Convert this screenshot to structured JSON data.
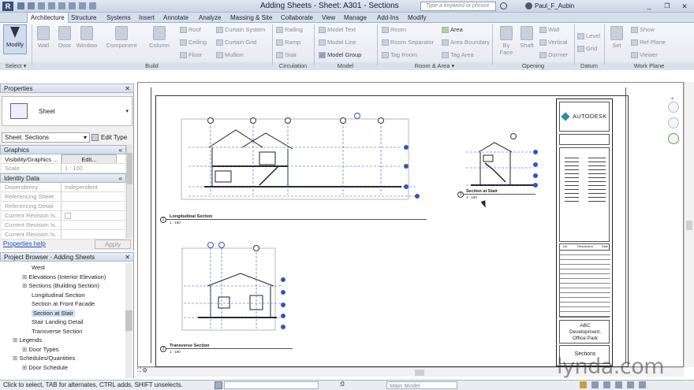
{
  "title": "Adding Sheets - Sheet: A301 - Sections",
  "search_placeholder": "Type a keyword or phrase",
  "user": "Paul_F_Aubin",
  "tabs": [
    "Architecture",
    "Structure",
    "Systems",
    "Insert",
    "Annotate",
    "Analyze",
    "Massing & Site",
    "Collaborate",
    "View",
    "Manage",
    "Add-Ins",
    "Modify"
  ],
  "ribbon": {
    "modify": "Modify",
    "wall": "Wall",
    "door": "Door",
    "window": "Window",
    "component": "Component",
    "column": "Column",
    "roof": "Roof",
    "ceiling": "Ceiling",
    "floor": "Floor",
    "curtain_system": "Curtain System",
    "curtain_grid": "Curtain Grid",
    "mullion": "Mullion",
    "railing": "Railing",
    "ramp": "Ramp",
    "stair": "Stair",
    "model_text": "Model Text",
    "model_line": "Model Line",
    "model_group": "Model Group",
    "room": "Room",
    "room_separator": "Room Separator",
    "tag_room": "Tag Room",
    "area": "Area",
    "area_boundary": "Area Boundary",
    "tag_area": "Tag Area",
    "by_face": "By Face",
    "shaft": "Shaft",
    "wall_op": "Wall",
    "vertical": "Vertical",
    "dormer": "Dormer",
    "level": "Level",
    "grid": "Grid",
    "set": "Set",
    "show": "Show",
    "ref_plane": "Ref Plane",
    "viewer": "Viewer",
    "panels": {
      "select": "Select",
      "build": "Build",
      "circulation": "Circulation",
      "model": "Model",
      "room_area": "Room & Area",
      "opening": "Opening",
      "datum": "Datum",
      "work_plane": "Work Plane"
    }
  },
  "properties": {
    "header": "Properties",
    "type_name": "Sheet",
    "selector": "Sheet: Sections",
    "edit_type": "Edit Type",
    "graphics": "Graphics",
    "rows": [
      {
        "label": "Visibility/Graphics ...",
        "value": "Edit..."
      },
      {
        "label": "Scale",
        "value": "1 : 100"
      }
    ],
    "identity": "Identity Data",
    "id_rows": [
      {
        "label": "Dependency",
        "value": "Independent"
      },
      {
        "label": "Referencing Sheet",
        "value": ""
      },
      {
        "label": "Referencing Detail",
        "value": ""
      },
      {
        "label": "Current Revision Is...",
        "value": ""
      },
      {
        "label": "Current Revision Is...",
        "value": ""
      },
      {
        "label": "Current Revision Is...",
        "value": ""
      }
    ],
    "help": "Properties help",
    "apply": "Apply"
  },
  "browser": {
    "header": "Project Browser - Adding Sheets",
    "items": [
      {
        "label": "West",
        "indent": 3
      },
      {
        "label": "Elevations (Interior Elevation)",
        "indent": 2
      },
      {
        "label": "Sections (Building Section)",
        "indent": 2
      },
      {
        "label": "Longitudinal Section",
        "indent": 3
      },
      {
        "label": "Section at Front Facade",
        "indent": 3
      },
      {
        "label": "Section at Stair",
        "indent": 3,
        "selected": true
      },
      {
        "label": "Stair Landing Detail",
        "indent": 3
      },
      {
        "label": "Transverse Section",
        "indent": 3
      },
      {
        "label": "Legends",
        "indent": 1
      },
      {
        "label": "Door Types",
        "indent": 2
      },
      {
        "label": "Schedules/Quantities",
        "indent": 1
      },
      {
        "label": "Door Schedule",
        "indent": 2
      }
    ]
  },
  "sheet": {
    "view1_title": "Longitudinal Section",
    "view2_title": "Section at Stair",
    "view3_title": "Transverse Section",
    "view1_num": "1",
    "view2_num": "3",
    "view3_num": "2",
    "scale_small": "1 : 100",
    "title_block": {
      "brand": "AUTODESK",
      "project_lines": [
        "ABC",
        "Development,",
        "Office Park"
      ],
      "sheet_name": "Sections",
      "rev_headers": [
        "No.",
        "Description",
        "Date"
      ]
    }
  },
  "status": {
    "hint": "Click to select, TAB for alternates, CTRL adds, SHIFT unselects.",
    "coord": ":0",
    "model": "Main Model"
  },
  "watermark": "lynda.com"
}
